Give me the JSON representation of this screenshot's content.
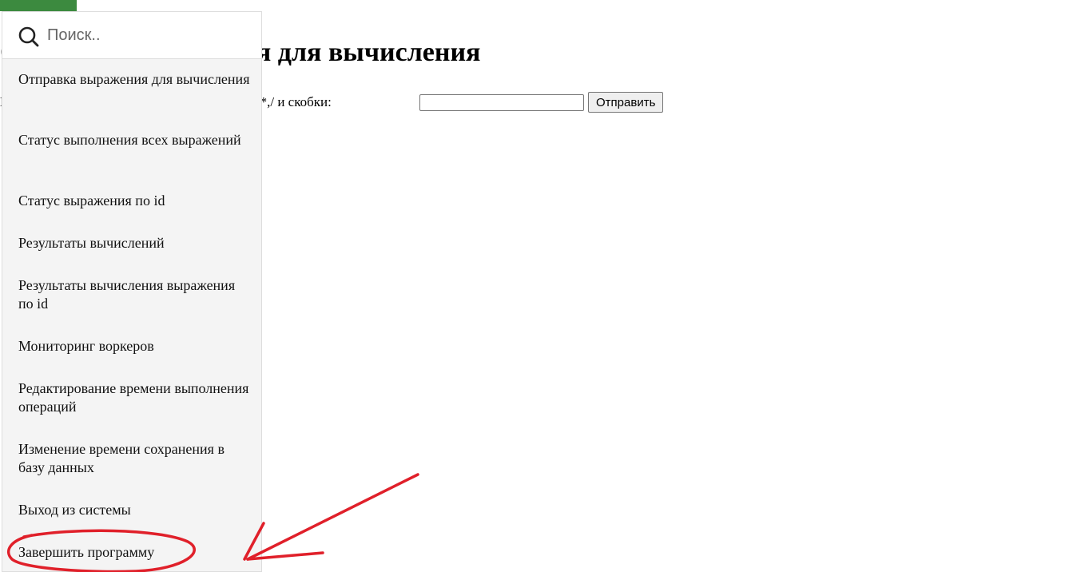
{
  "main": {
    "title": "Отправка выражения для вычисления",
    "expression_label": "Введите выражение, используя операции +,-,*,/ и скобки:",
    "expression_value": "",
    "submit_label": "Отправить"
  },
  "sidebar": {
    "search_placeholder": "Поиск..",
    "search_value": "",
    "items": [
      {
        "label": "Отправка выражения для вычисления"
      },
      {
        "label": "Статус выполнения всех выражений"
      },
      {
        "label": "Статус выражения по id"
      },
      {
        "label": "Результаты вычислений"
      },
      {
        "label": "Результаты вычисления выражения по id"
      },
      {
        "label": "Мониторинг воркеров"
      },
      {
        "label": "Редактирование времени выполнения операций"
      },
      {
        "label": "Изменение времени сохранения в базу данных"
      },
      {
        "label": "Выход из системы"
      },
      {
        "label": "Завершить программу"
      }
    ]
  },
  "annotation": {
    "color": "#e0202a"
  },
  "colors": {
    "top_bar": "#3c8a3f",
    "sidebar_bg": "#f4f4f4"
  }
}
